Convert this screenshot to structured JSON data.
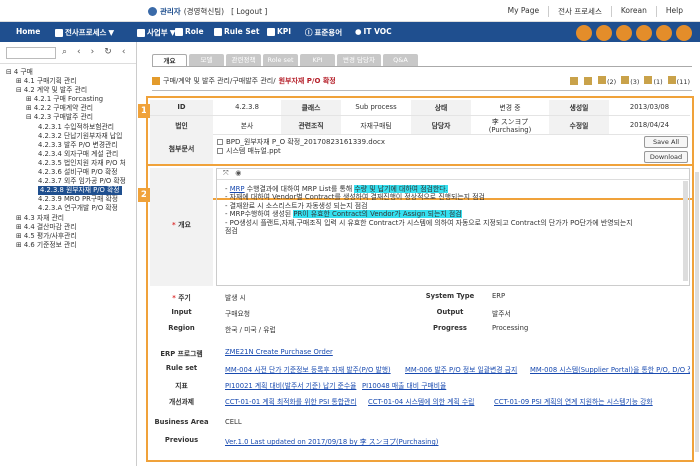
{
  "header": {
    "user_name": "관리자",
    "user_org": "(경영혁신팀)",
    "logout": "[ Logout ]",
    "links": [
      "My Page",
      "전사 프로세스",
      "Korean",
      "Help"
    ]
  },
  "menu": {
    "home": "Home",
    "process": "전사프로세스",
    "business": "사업부",
    "role": "Role",
    "ruleset": "Rule Set",
    "kpi": "KPI",
    "term": "표준용어",
    "itvoc": "IT VOC"
  },
  "tree": [
    "⊟ 4 구매",
    "⊞ 4.1 구매기획 관리",
    "⊟ 4.2 계약 및 발주 관리",
    "⊞ 4.2.1 구매 Forcasting",
    "⊞ 4.2.2 구매계약 관리",
    "⊟ 4.2.3 구매발주 관리",
    "4.2.3.1 수입적하보험관리",
    "4.2.3.2 단납기원부자재 납입",
    "4.2.3.3 발주 P/O 변경관리",
    "4.2.3.4 외자구매 계설 관리",
    "4.2.3.5 법인지원 자재 P/O 처",
    "4.2.3.6 설비구매 P/O 확정",
    "4.2.3.7 외주 임가공 P/O 확정",
    "4.2.3.8 원부자재 P/O 확정",
    "4.2.3.9 MRO PR구매 확정",
    "4.2.3.A 연구개발 P/O 확정",
    "⊞ 4.3 자재 관리",
    "⊞ 4.4 결산마감 관리",
    "⊞ 4.5 평가/사후관리",
    "⊞ 4.6 기준정보 관리"
  ],
  "tabs": [
    "개요",
    "모델",
    "관련정책",
    "Role set",
    "KPI",
    "변경 담당자",
    "Q&A"
  ],
  "breadcrumb": {
    "prefix": "구매/계약 및 발주 관리/구매발주 관리/",
    "current": "원부자재 P/O 확정"
  },
  "actions": [
    "(2)",
    "(3)",
    "(1)",
    "(11)"
  ],
  "info": {
    "id_label": "ID",
    "id": "4.2.3.8",
    "class_label": "클래스",
    "class": "Sub process",
    "state_label": "상태",
    "state": "변경 중",
    "created_label": "생성일",
    "created": "2013/03/08",
    "corp_label": "법인",
    "corp": "본사",
    "org_label": "관련조직",
    "org": "자재구매팀",
    "owner_label": "담당자",
    "owner": "李 スンヨプ(Purchasing)",
    "modified_label": "수정일",
    "modified": "2018/04/24",
    "attach_label": "첨부문서",
    "files": [
      "BPD_원부자재 P_O 확정_20170823161339.docx",
      "시스템 매뉴얼.ppt"
    ],
    "save_all": "Save All",
    "download": "Download"
  },
  "badges": [
    "1",
    "2"
  ],
  "overview": {
    "label": "개요",
    "lines": [
      {
        "pre": "- ",
        "link": "MRP",
        "mid": " 수행결과에 대하여 MRP List를 통해 ",
        "hl": "수량 및 납기에 대하여 점검한다.",
        "post": ""
      },
      {
        "pre": "- 자재에 대하여 Vendor별 Contract를 생성하여 결재진행이 정상적으로 진행되는지 점검",
        "link": "",
        "mid": "",
        "hl": "",
        "post": ""
      },
      {
        "pre": "- 결재완료 시 소스리스트가 자동생성 되는지 점검",
        "link": "",
        "mid": "",
        "hl": "",
        "post": ""
      },
      {
        "pre": "- MRP수행하여 생성된 ",
        "link": "",
        "mid": "",
        "hl": "PR이 유효한 Contract의 Vendor가 Assign 되는지 점검",
        "post": ""
      },
      {
        "pre": "- PO생성시 플랜트,자재,구매조직 입력 시 유효한 Contract가 시스템에 의하여 자동으로 지정되고 Contract의 단가가 PO단가에 반영되는지",
        "link": "",
        "mid": "",
        "hl": "",
        "post": ""
      },
      {
        "pre": "  점검",
        "link": "",
        "mid": "",
        "hl": "",
        "post": ""
      }
    ]
  },
  "fields": {
    "cycle_label": "주기",
    "cycle": "발생 시",
    "systype_label": "System Type",
    "systype": "ERP",
    "input_label": "Input",
    "input": "구매요청",
    "output_label": "Output",
    "output": "발주서",
    "region_label": "Region",
    "region": "한국 / 미국 / 유럽",
    "progress_label": "Progress",
    "progress": "Processing"
  },
  "links": {
    "erp_label": "ERP 프로그램",
    "erp": "ZME21N Create Purchase Order",
    "rule_label": "Rule set",
    "rules": [
      "MM-004 사전 단가 기준정보 등록후 자재 발주(P/O 발행)",
      "MM-006 발주 P/O 정보 일괄변경 금지",
      "MM-008 시스템(Supplier Portal)을 통한 P/O, D/O 전송"
    ],
    "kpi_label": "지표",
    "kpis": [
      "PI10021 계획 대비(발주서 기준) 납기 준수율",
      "PI10048 매출 대비 구매비율"
    ],
    "task_label": "개선과제",
    "tasks": [
      "CCT-01-01 계획 최적화를 위한 PSI 통합관리",
      "CCT-01-04 시스템에 의한 계획 수립",
      "CCT-01-09 PSI 계획의 연계 지원하는 시스템기능 강화"
    ],
    "area_label": "Business Area",
    "area": "CELL",
    "prev_label": "Previous",
    "prev": "Ver.1.0 Last updated on 2017/09/18  by 李 スンヨプ(Purchasing)"
  }
}
